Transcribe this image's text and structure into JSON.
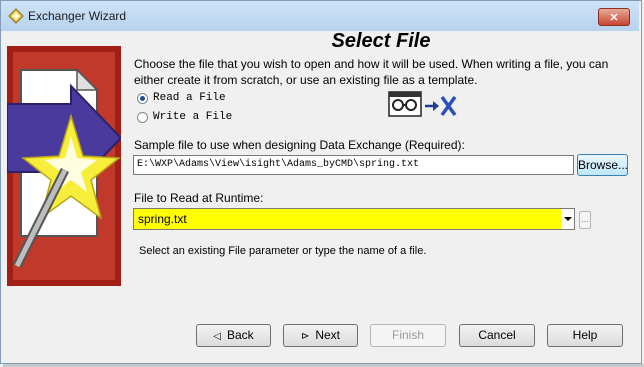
{
  "window": {
    "title": "Exchanger Wizard",
    "close_glyph": "✕"
  },
  "page": {
    "heading": "Select File",
    "description": "Choose the file that you wish to open and how it will be used. When writing a file, you can either create it from scratch, or use an existing file as a template."
  },
  "modes": {
    "read_label": "Read a File",
    "write_label": "Write a File",
    "selected": "read"
  },
  "sample": {
    "label": "Sample file to use when designing Data Exchange (Required):",
    "value": "E:\\WXP\\Adams\\View\\isight\\Adams_byCMD\\spring.txt",
    "browse_label": "Browse..."
  },
  "runtime": {
    "label": "File to Read at Runtime:",
    "value": "spring.txt",
    "dots_label": "...",
    "hint": "Select an existing File parameter or type the name of a file."
  },
  "buttons": {
    "back": "Back",
    "next": "Next",
    "finish": "Finish",
    "cancel": "Cancel",
    "help": "Help",
    "finish_enabled": false
  },
  "colors": {
    "runtime_field_bg": "#ffff00",
    "titlebar": "#b7d2ee",
    "close_button": "#c7452f"
  },
  "icons": [
    "app-icon",
    "wizard-art-icon",
    "exchanger-icon",
    "close-icon",
    "back-arrow-icon",
    "next-arrow-icon",
    "dropdown-arrow-icon"
  ]
}
